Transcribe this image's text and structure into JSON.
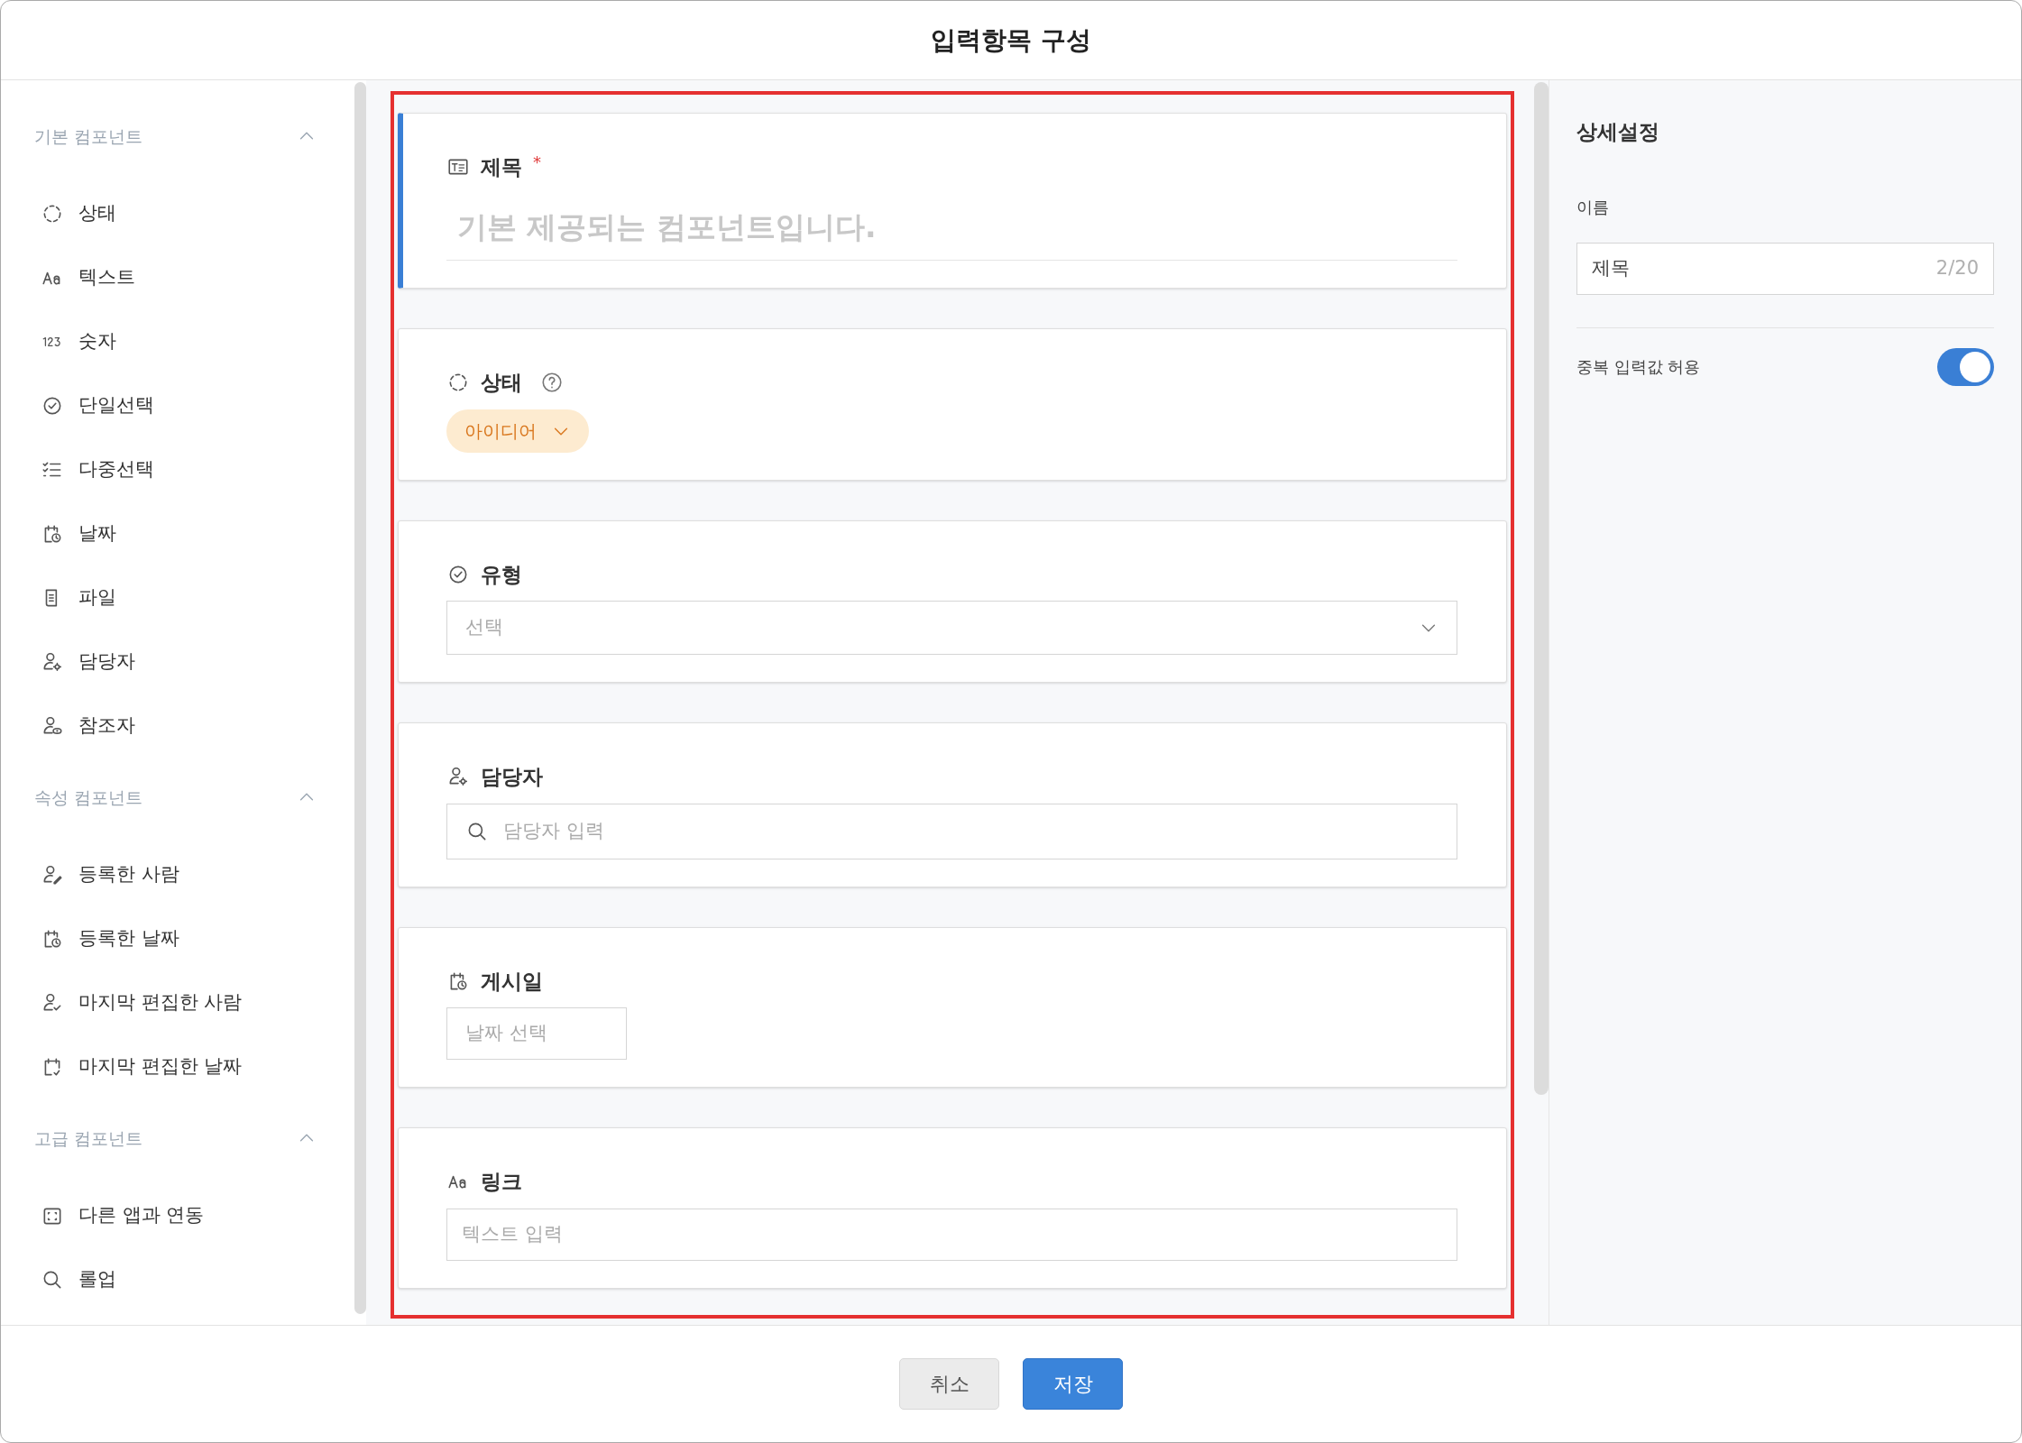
{
  "window": {
    "title": "입력항목 구성"
  },
  "sidebar": {
    "sections": [
      {
        "title": "기본 컴포넌트",
        "expanded": true,
        "items": [
          {
            "label": "상태",
            "kind": "status"
          },
          {
            "label": "텍스트",
            "kind": "text"
          },
          {
            "label": "숫자",
            "kind": "number"
          },
          {
            "label": "단일선택",
            "kind": "single"
          },
          {
            "label": "다중선택",
            "kind": "multi"
          },
          {
            "label": "날짜",
            "kind": "date"
          },
          {
            "label": "파일",
            "kind": "file"
          },
          {
            "label": "담당자",
            "kind": "assignee"
          },
          {
            "label": "참조자",
            "kind": "reference"
          }
        ]
      },
      {
        "title": "속성 컴포넌트",
        "expanded": true,
        "items": [
          {
            "label": "등록한 사람",
            "kind": "creator"
          },
          {
            "label": "등록한 날짜",
            "kind": "date"
          },
          {
            "label": "마지막 편집한 사람",
            "kind": "editor"
          },
          {
            "label": "마지막 편집한 날짜",
            "kind": "edited"
          }
        ]
      },
      {
        "title": "고급 컴포넌트",
        "expanded": true,
        "items": [
          {
            "label": "다른 앱과 연동",
            "kind": "integration"
          },
          {
            "label": "롤업",
            "kind": "rollup"
          }
        ]
      }
    ]
  },
  "form": {
    "required_mark": "*",
    "fields": [
      {
        "kind": "title",
        "label": "제목",
        "required": true,
        "selected": true,
        "placeholder": "기본 제공되는 컴포넌트입니다."
      },
      {
        "kind": "status",
        "label": "상태",
        "required": false,
        "selected": false,
        "value": "아이디어"
      },
      {
        "kind": "select",
        "label": "유형",
        "required": false,
        "selected": false,
        "placeholder": "선택"
      },
      {
        "kind": "person",
        "label": "담당자",
        "required": false,
        "selected": false,
        "placeholder": "담당자 입력"
      },
      {
        "kind": "date",
        "label": "게시일",
        "required": false,
        "selected": false,
        "placeholder": "날짜 선택"
      },
      {
        "kind": "text",
        "label": "링크",
        "required": false,
        "selected": false,
        "placeholder": "텍스트 입력"
      }
    ]
  },
  "details": {
    "title": "상세설정",
    "name_label": "이름",
    "name_value": "제목",
    "name_counter": "2/20",
    "duplicate_label": "중복 입력값 허용",
    "duplicate_on": true
  },
  "buttons": [
    {
      "label": "취소",
      "kind": "secondary"
    },
    {
      "label": "저장",
      "kind": "primary"
    }
  ]
}
